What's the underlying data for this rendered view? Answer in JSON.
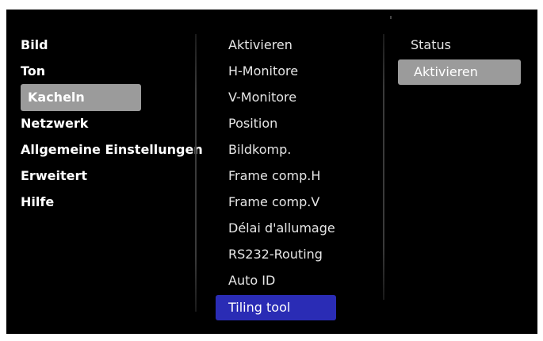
{
  "main_menu": {
    "items": [
      {
        "label": "Bild",
        "selected": false
      },
      {
        "label": "Ton",
        "selected": false
      },
      {
        "label": "Kacheln",
        "selected": true
      },
      {
        "label": "Netzwerk",
        "selected": false
      },
      {
        "label": "Allgemeine Einstellungen",
        "selected": false
      },
      {
        "label": "Erweitert",
        "selected": false
      },
      {
        "label": "Hilfe",
        "selected": false
      }
    ]
  },
  "submenu": {
    "items": [
      {
        "label": "Aktivieren"
      },
      {
        "label": "H-Monitore"
      },
      {
        "label": "V-Monitore"
      },
      {
        "label": "Position"
      },
      {
        "label": "Bildkomp."
      },
      {
        "label": "Frame comp.H"
      },
      {
        "label": "Frame comp.V"
      },
      {
        "label": "Délai d'allumage"
      },
      {
        "label": "RS232-Routing"
      },
      {
        "label": "Auto ID"
      },
      {
        "label": "Tiling tool",
        "selected": true
      }
    ]
  },
  "options": {
    "items": [
      {
        "label": "Status"
      },
      {
        "label": "Aktivieren",
        "selected": true
      }
    ]
  },
  "colors": {
    "background": "#000000",
    "highlight_gray": "#9b9b9b",
    "highlight_blue": "#2a2cb5",
    "text": "#ffffff"
  }
}
